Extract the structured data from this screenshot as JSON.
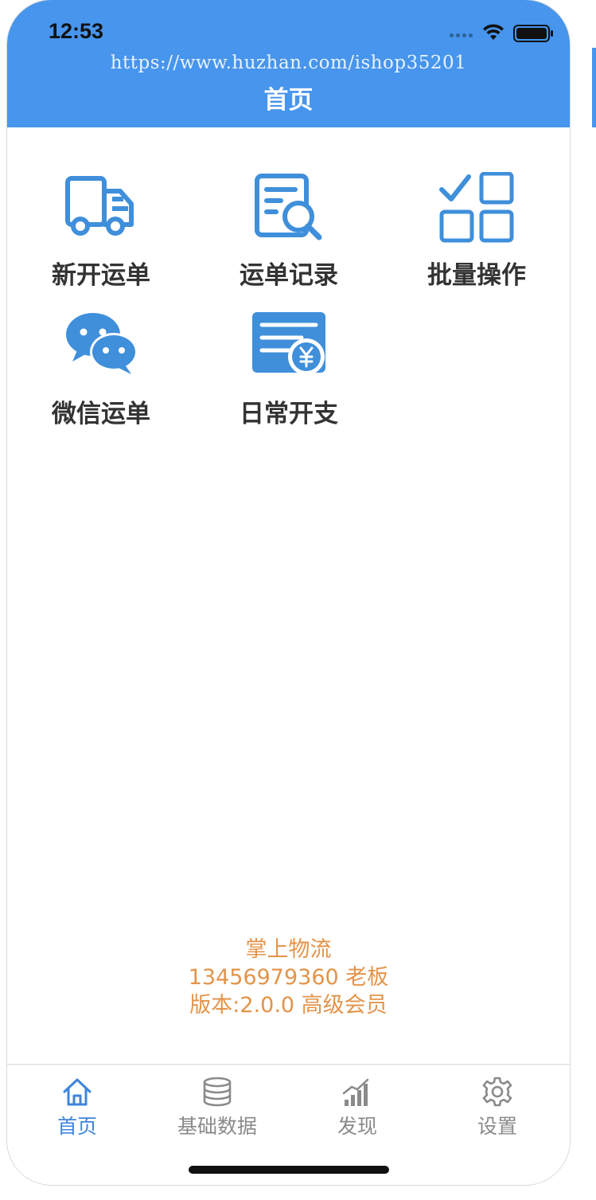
{
  "status_bar": {
    "time": "12:53",
    "icons": [
      "signal-dots-icon",
      "wifi-icon",
      "battery-icon"
    ]
  },
  "header": {
    "watermark": "https://www.huzhan.com/ishop35201",
    "title": "首页",
    "background_color": "#4795ec"
  },
  "menu": [
    {
      "label": "新开运单",
      "icon": "truck-icon"
    },
    {
      "label": "运单记录",
      "icon": "document-search-icon"
    },
    {
      "label": "批量操作",
      "icon": "batch-check-grid-icon"
    },
    {
      "label": "微信运单",
      "icon": "wechat-icon"
    },
    {
      "label": "日常开支",
      "icon": "expense-card-icon"
    }
  ],
  "info": {
    "app_name": "掌上物流",
    "account": "13456979360 老板",
    "version": "版本:2.0.0 高级会员",
    "color": "#e3944a"
  },
  "tabs": [
    {
      "label": "首页",
      "icon": "home-icon",
      "active": true
    },
    {
      "label": "基础数据",
      "icon": "database-icon",
      "active": false
    },
    {
      "label": "发现",
      "icon": "chart-bars-icon",
      "active": false
    },
    {
      "label": "设置",
      "icon": "gear-icon",
      "active": false
    }
  ],
  "colors": {
    "accent": "#4795ec",
    "icon_blue": "#3f8fdb",
    "active_tab": "#3e85d9",
    "inactive_tab": "#8a8a8a"
  }
}
